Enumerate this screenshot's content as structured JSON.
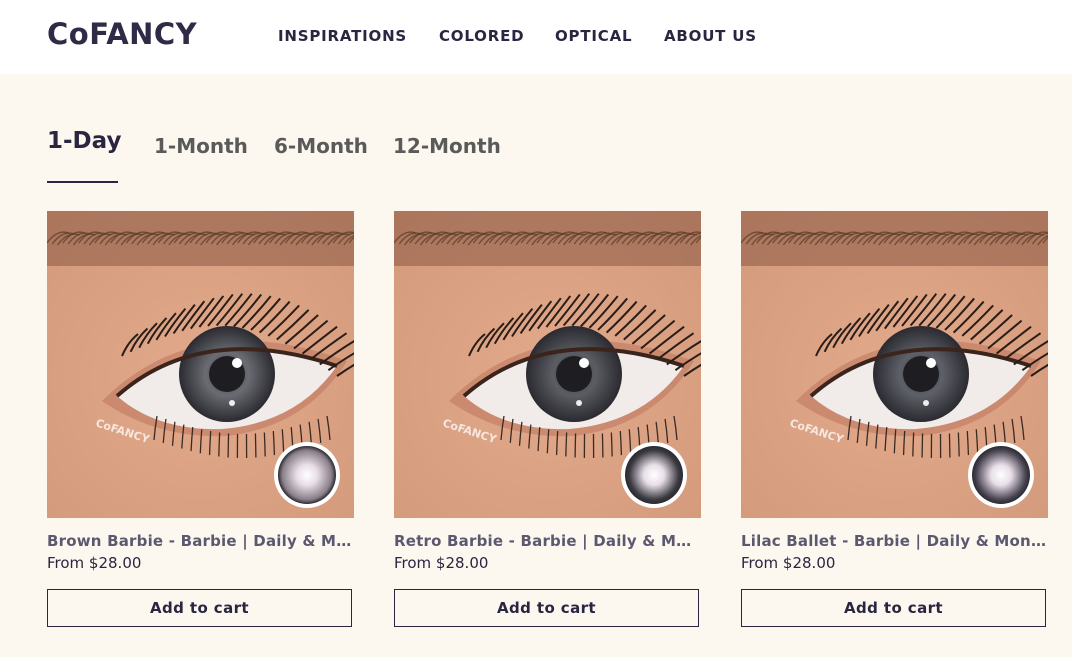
{
  "header": {
    "logo": "CoFANCY",
    "nav": [
      {
        "label": "INSPIRATIONS"
      },
      {
        "label": "COLORED"
      },
      {
        "label": "OPTICAL"
      },
      {
        "label": "ABOUT US"
      }
    ]
  },
  "tabs": [
    {
      "label": "1-Day",
      "active": true
    },
    {
      "label": "1-Month",
      "active": false
    },
    {
      "label": "6-Month",
      "active": false
    },
    {
      "label": "12-Month",
      "active": false
    }
  ],
  "products": [
    {
      "title": "Brown Barbie - Barbie | Daily & Monthly",
      "price": "From $28.00",
      "button": "Add to cart",
      "watermark": "CoFANCY",
      "iris_color": "#6b6c73",
      "lens_color": "#8a7f88"
    },
    {
      "title": "Retro Barbie - Barbie | Daily & Monthly",
      "price": "From $28.00",
      "button": "Add to cart",
      "watermark": "CoFANCY",
      "iris_color": "#5b5d63",
      "lens_color": "#3a3a40"
    },
    {
      "title": "Lilac Ballet - Barbie | Daily & Monthly",
      "price": "From $28.00",
      "button": "Add to cart",
      "watermark": "CoFANCY",
      "iris_color": "#5e6068",
      "lens_color": "#4a4452"
    }
  ],
  "colors": {
    "page_bg": "#fdf8ef",
    "text_dark": "#2a2540",
    "skin": "#d49a7c"
  }
}
